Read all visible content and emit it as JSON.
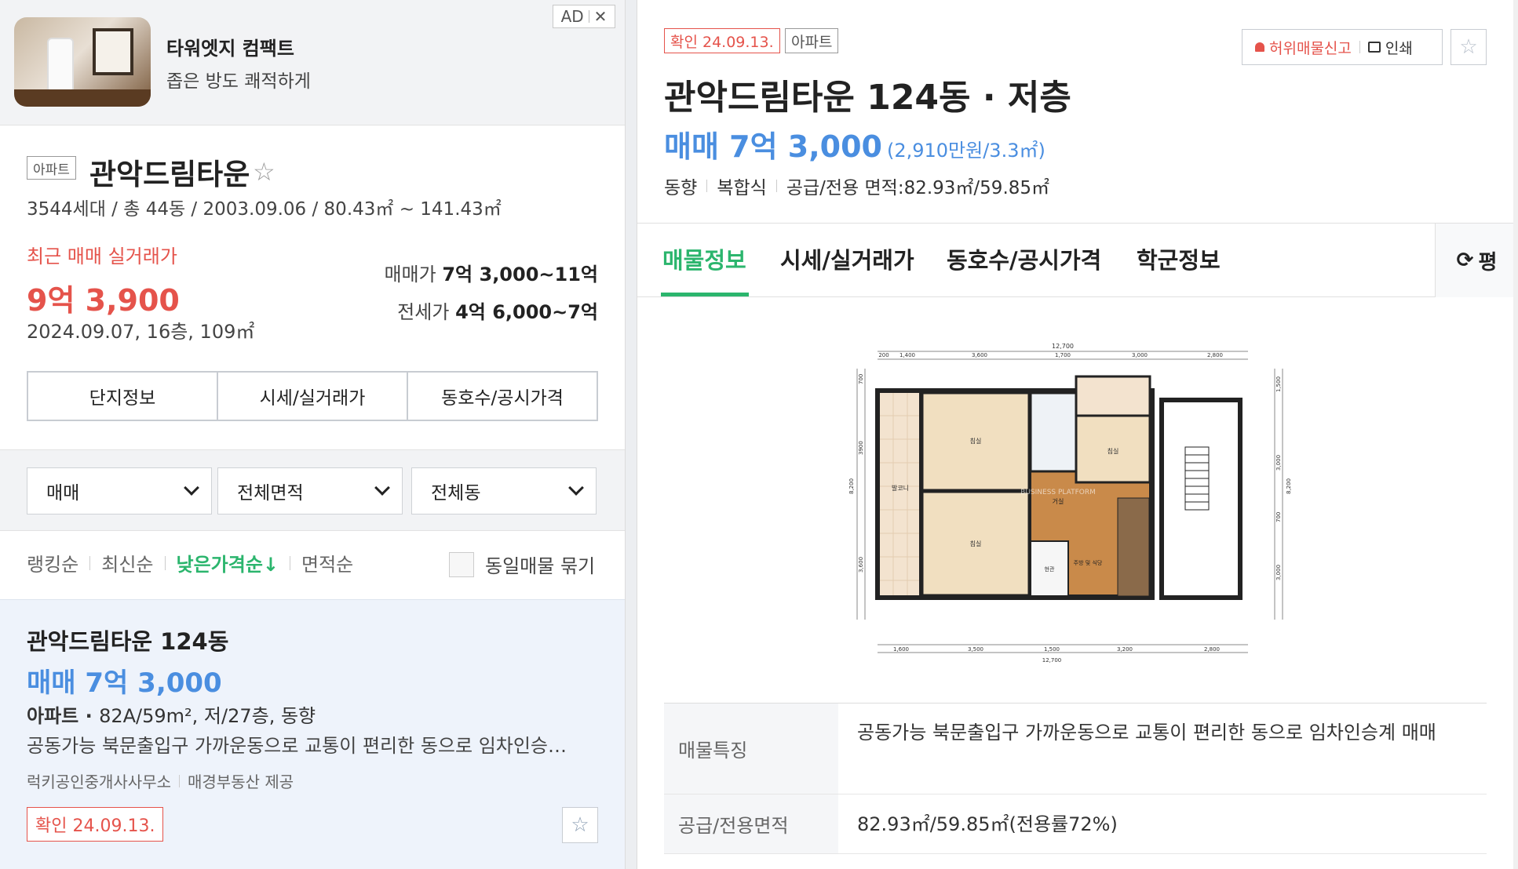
{
  "ad": {
    "title": "타워엣지 컴팩트",
    "subtitle": "좁은 방도 쾌적하게",
    "badge": "AD",
    "close": "✕"
  },
  "complex": {
    "type_tag": "아파트",
    "name": "관악드림타운",
    "star": "☆",
    "meta": "3544세대 / 총 44동 / 2003.09.06 / 80.43㎡ ~ 141.43㎡",
    "recent_label": "최근 매매 실거래가",
    "recent_price": "9억 3,900",
    "recent_detail": "2024.09.07, 16층, 109㎡",
    "sale_range_label": "매매가",
    "sale_range": "7억 3,000~11억",
    "jeonse_range_label": "전세가",
    "jeonse_range": "4억 6,000~7억",
    "tabs": [
      "단지정보",
      "시세/실거래가",
      "동호수/공시가격"
    ]
  },
  "filters": {
    "trade": "매매",
    "area": "전체면적",
    "dong": "전체동"
  },
  "sort": {
    "items": [
      "랭킹순",
      "최신순",
      "낮은가격순↓",
      "면적순"
    ],
    "active_index": 2,
    "group_label": "동일매물 묶기"
  },
  "listing": {
    "title": "관악드림타운 124동",
    "price": "매매 7억 3,000",
    "spec_type": "아파트 · ",
    "spec": "82A/59m², 저/27층, 동향",
    "desc": "공동가능 북문출입구 가까운동으로 교통이 편리한 동으로 임차인승…",
    "agent": "럭키공인중개사사무소",
    "provider": "매경부동산 제공",
    "confirm": "확인 24.09.13.",
    "star": "☆"
  },
  "detail": {
    "confirm": "확인 24.09.13.",
    "type": "아파트",
    "report_label": "허위매물신고",
    "print_label": "인쇄",
    "star": "☆",
    "title": "관악드림타운 124동 · 저층",
    "price": "매매 7억 3,000",
    "unit_price": "(2,910만원/3.3㎡)",
    "direction": "동향",
    "structure": "복합식",
    "area": "공급/전용 면적:82.93㎡/59.85㎡",
    "tabs": [
      "매물정보",
      "시세/실거래가",
      "동호수/공시가격",
      "학군정보"
    ],
    "active_tab": 0,
    "unit_toggle": "평",
    "features_label": "매물특징",
    "features": "공동가능 북문출입구 가까운동으로 교통이 편리한 동으로 임차인승계 매매",
    "area_label": "공급/전용면적",
    "area_value": "82.93㎡/59.85㎡(전용률72%)"
  },
  "floorplan": {
    "top_total": "12,700",
    "top_dims": [
      "200",
      "1,400",
      "3,600",
      "1,700",
      "3,000",
      "2,800"
    ],
    "bottom_dims": [
      "1,600",
      "3,500",
      "1,500",
      "3,200",
      "2,800"
    ],
    "bottom_total": "12,700",
    "left_dims": [
      "700",
      "3900",
      "3,600"
    ],
    "left_total": "8,200",
    "right_dims": [
      "1,500",
      "3,000",
      "700",
      "3,000"
    ],
    "right_total": "8,200",
    "rooms": [
      "침실",
      "침실",
      "침실",
      "발코니",
      "거실",
      "현관",
      "주방 및 식당"
    ],
    "watermark": "BUSINESS PLATFORM"
  },
  "colors": {
    "accent_green": "#2bb56d",
    "price_blue": "#4a8ee0",
    "red": "#e5534b"
  }
}
